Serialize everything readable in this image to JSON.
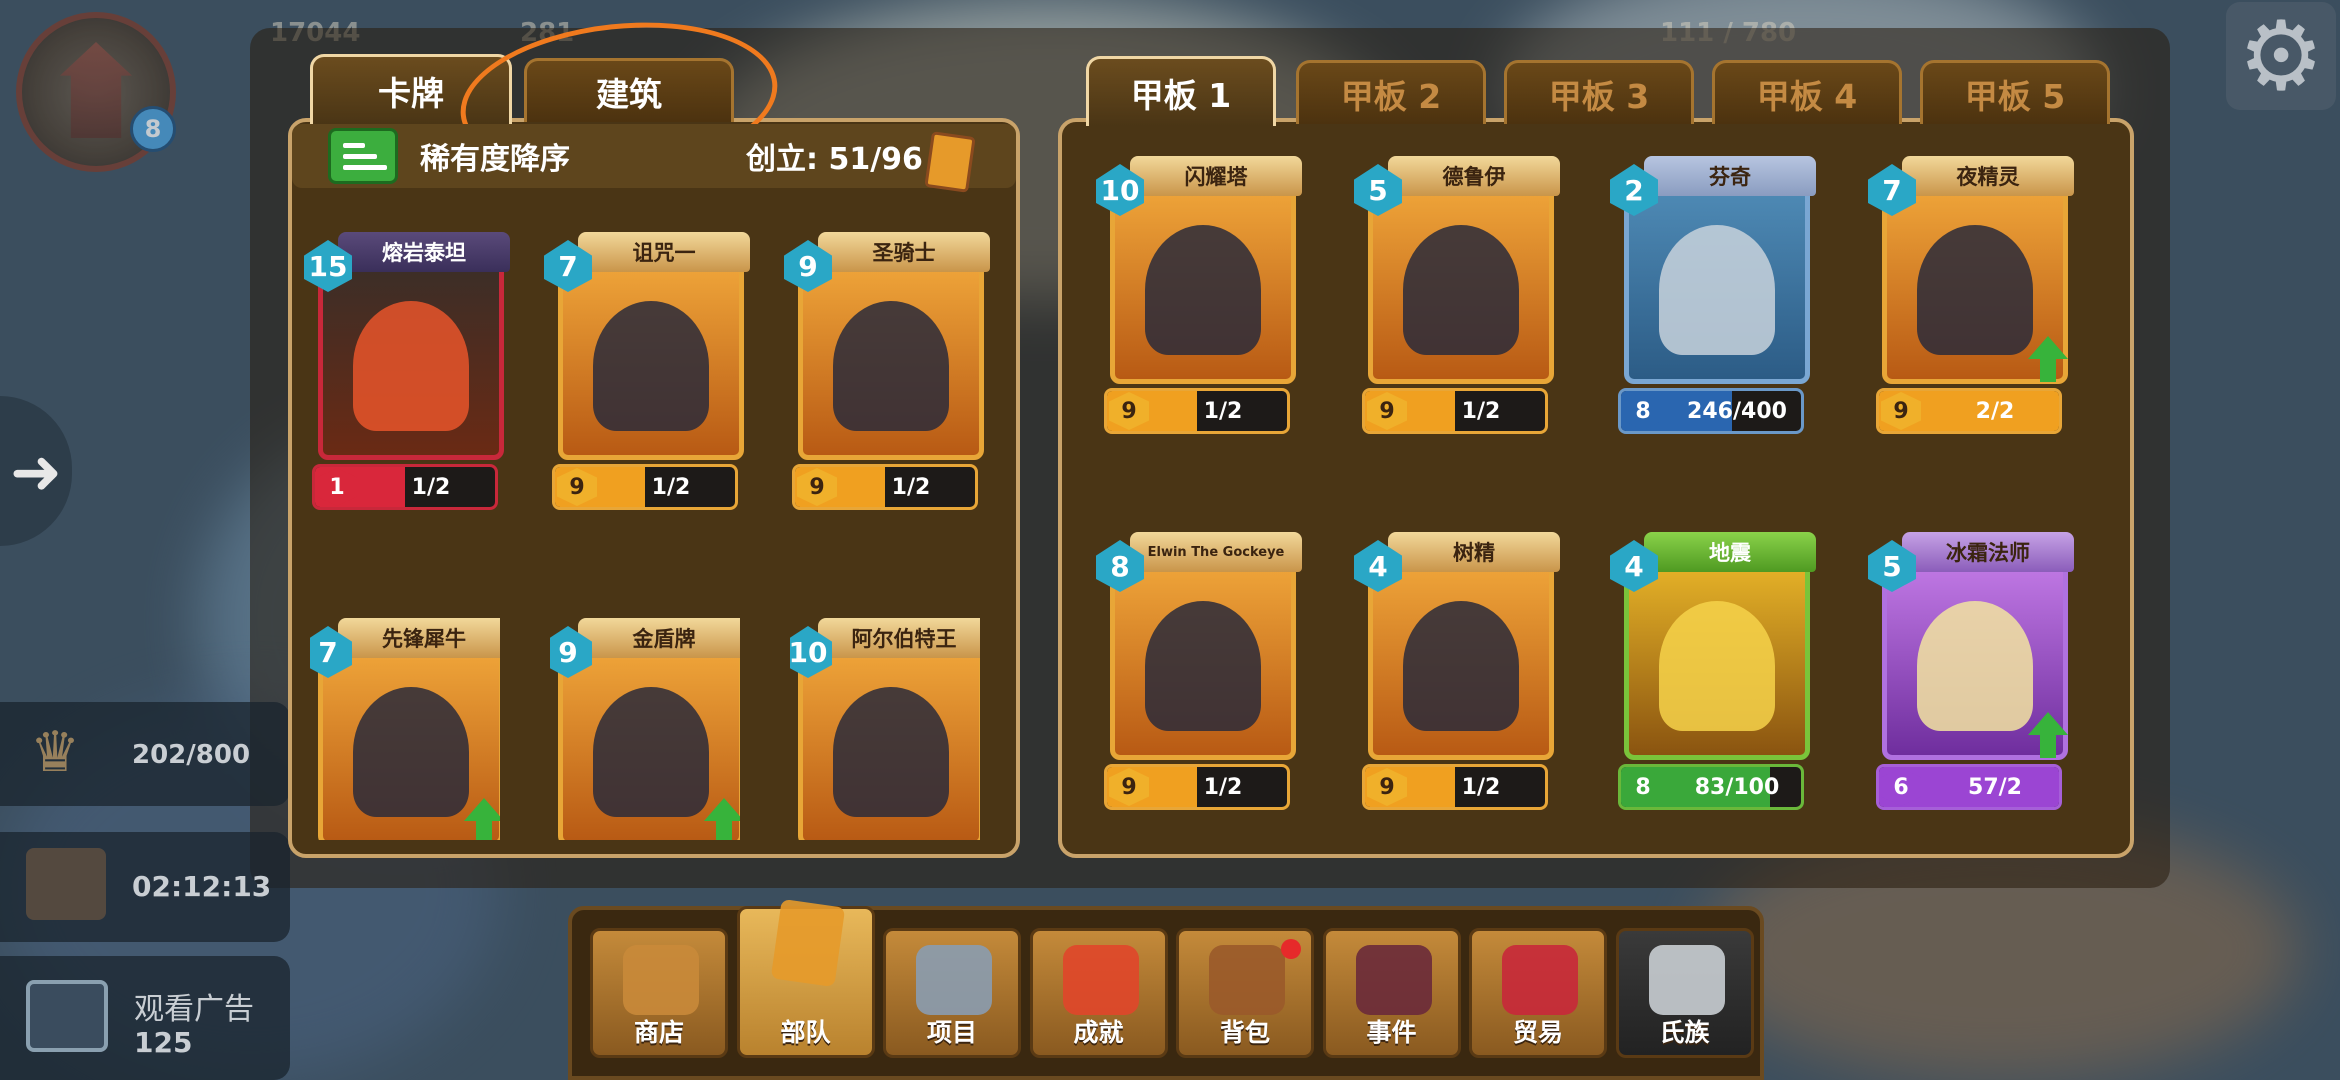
{
  "hud": {
    "player_level": "8",
    "coins": "17044",
    "gems": "281",
    "top_right_value": "111 / 780",
    "settings_icon": "gear-icon"
  },
  "side": {
    "crown_value": "202/800",
    "chest_timer": "02:12:13",
    "watch_ad_label": "观看广告",
    "watch_ad_reward": "125"
  },
  "left_tabs": [
    {
      "label": "卡牌",
      "active": true
    },
    {
      "label": "建筑",
      "active": false
    }
  ],
  "deck_tabs": [
    {
      "label": "甲板 1",
      "active": true
    },
    {
      "label": "甲板 2",
      "active": false
    },
    {
      "label": "甲板 3",
      "active": false
    },
    {
      "label": "甲板 4",
      "active": false
    },
    {
      "label": "甲板 5",
      "active": false
    }
  ],
  "collection": {
    "sort_label": "稀有度降序",
    "created_label": "创立: 51/96"
  },
  "collection_cards": [
    {
      "name": "熔岩泰坦",
      "level": "15",
      "bar_level": "1",
      "progress_text": "1/2",
      "progress": 0.5,
      "rarity": "red"
    },
    {
      "name": "诅咒一",
      "level": "7",
      "bar_level": "9",
      "progress_text": "1/2",
      "progress": 0.5,
      "rarity": "orange"
    },
    {
      "name": "圣骑士",
      "level": "9",
      "bar_level": "9",
      "progress_text": "1/2",
      "progress": 0.5,
      "rarity": "orange"
    },
    {
      "name": "先锋犀牛",
      "level": "7",
      "rarity": "orange",
      "upgrade": true
    },
    {
      "name": "金盾牌",
      "level": "9",
      "rarity": "orange",
      "upgrade": true
    },
    {
      "name": "阿尔伯特王",
      "level": "10",
      "rarity": "orange"
    }
  ],
  "deck_cards": [
    {
      "name": "闪耀塔",
      "level": "10",
      "bar_level": "9",
      "progress_text": "1/2",
      "progress": 0.5,
      "rarity": "orange"
    },
    {
      "name": "德鲁伊",
      "level": "5",
      "bar_level": "9",
      "progress_text": "1/2",
      "progress": 0.5,
      "rarity": "orange"
    },
    {
      "name": "芬奇",
      "level": "2",
      "bar_level": "8",
      "progress_text": "246/400",
      "progress": 0.615,
      "rarity": "blue"
    },
    {
      "name": "夜精灵",
      "level": "7",
      "bar_level": "9",
      "progress_text": "2/2",
      "progress": 1.0,
      "rarity": "orange",
      "upgrade": true
    },
    {
      "name": "Elwin The Gockeye",
      "level": "8",
      "bar_level": "9",
      "progress_text": "1/2",
      "progress": 0.5,
      "rarity": "orange"
    },
    {
      "name": "树精",
      "level": "4",
      "bar_level": "9",
      "progress_text": "1/2",
      "progress": 0.5,
      "rarity": "orange"
    },
    {
      "name": "地震",
      "level": "4",
      "bar_level": "8",
      "progress_text": "83/100",
      "progress": 0.83,
      "rarity": "green"
    },
    {
      "name": "冰霜法师",
      "level": "5",
      "bar_level": "6",
      "progress_text": "57/2",
      "progress": 1.0,
      "rarity": "purple",
      "upgrade": true
    }
  ],
  "nav": [
    {
      "label": "商店",
      "icon": "money-bag-icon"
    },
    {
      "label": "部队",
      "icon": "card-icon",
      "active": true
    },
    {
      "label": "项目",
      "icon": "sword-shield-icon"
    },
    {
      "label": "成就",
      "icon": "medal-icon"
    },
    {
      "label": "背包",
      "icon": "backpack-icon",
      "badge": true
    },
    {
      "label": "事件",
      "icon": "skull-gate-icon"
    },
    {
      "label": "贸易",
      "icon": "market-stall-icon"
    },
    {
      "label": "氏族",
      "icon": "castle-icon"
    }
  ],
  "colors": {
    "accent": "#e8a637",
    "panel_bg": "#4a3515",
    "annotation": "#f07a1e"
  }
}
